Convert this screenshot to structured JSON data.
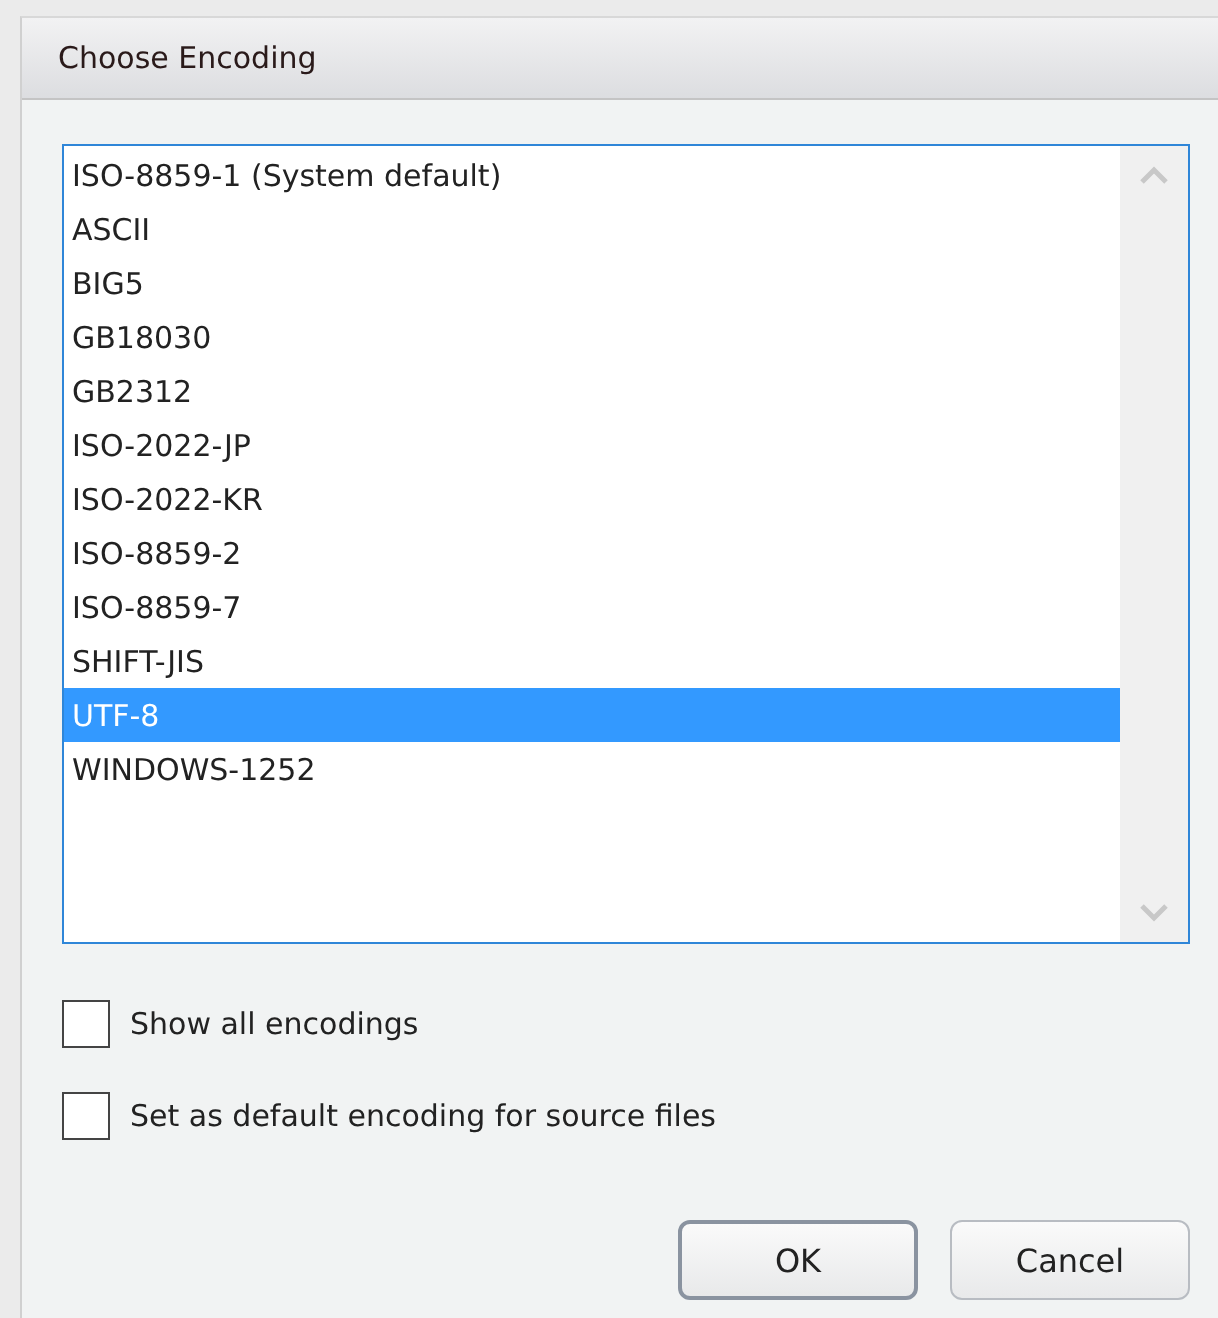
{
  "window": {
    "title": "Choose Encoding"
  },
  "encodings": [
    {
      "label": "ISO-8859-1 (System default)",
      "selected": false
    },
    {
      "label": "ASCII",
      "selected": false
    },
    {
      "label": "BIG5",
      "selected": false
    },
    {
      "label": "GB18030",
      "selected": false
    },
    {
      "label": "GB2312",
      "selected": false
    },
    {
      "label": "ISO-2022-JP",
      "selected": false
    },
    {
      "label": "ISO-2022-KR",
      "selected": false
    },
    {
      "label": "ISO-8859-2",
      "selected": false
    },
    {
      "label": "ISO-8859-7",
      "selected": false
    },
    {
      "label": "SHIFT-JIS",
      "selected": false
    },
    {
      "label": "UTF-8",
      "selected": true
    },
    {
      "label": "WINDOWS-1252",
      "selected": false
    }
  ],
  "options": [
    {
      "label": "Show all encodings",
      "checked": false
    },
    {
      "label": "Set as default encoding for source files",
      "checked": false
    }
  ],
  "buttons": [
    {
      "label": "OK",
      "default": true
    },
    {
      "label": "Cancel",
      "default": false
    }
  ]
}
